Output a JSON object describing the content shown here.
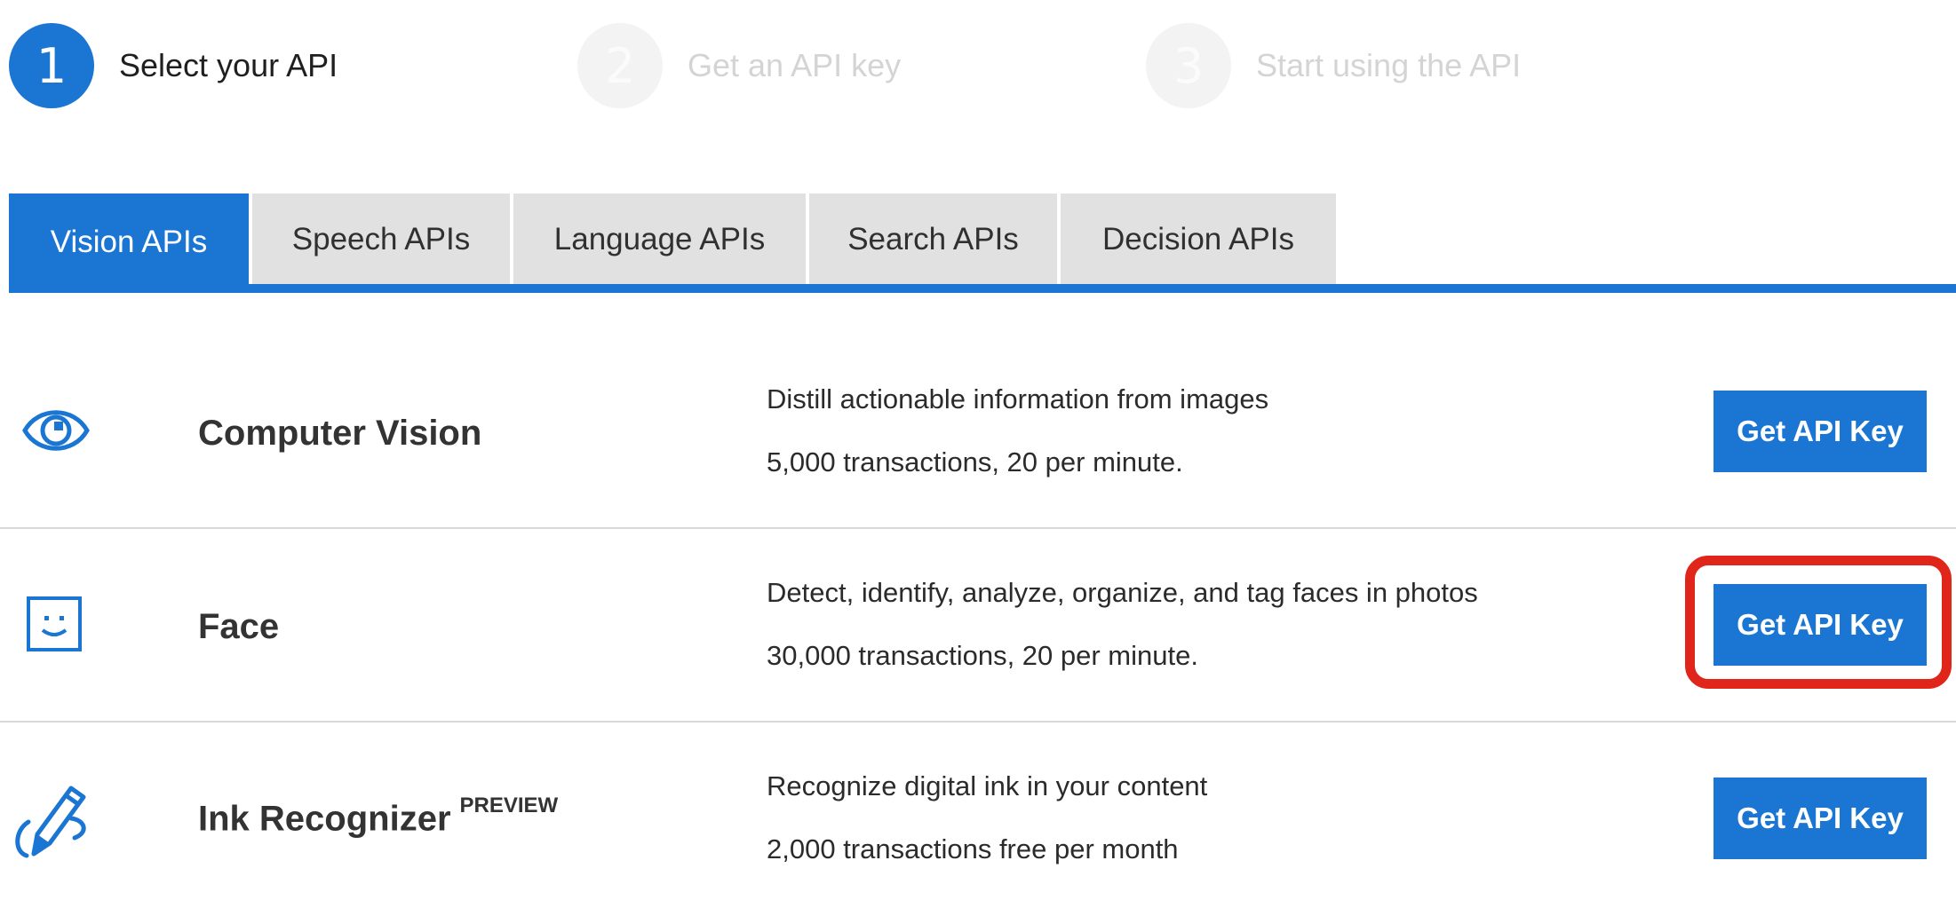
{
  "steps": [
    {
      "number": "1",
      "label": "Select your API"
    },
    {
      "number": "2",
      "label": "Get an API key"
    },
    {
      "number": "3",
      "label": "Start using the API"
    }
  ],
  "tabs": [
    {
      "label": "Vision APIs",
      "active": true
    },
    {
      "label": "Speech APIs",
      "active": false
    },
    {
      "label": "Language APIs",
      "active": false
    },
    {
      "label": "Search APIs",
      "active": false
    },
    {
      "label": "Decision APIs",
      "active": false
    }
  ],
  "apis": [
    {
      "icon": "eye-icon",
      "title": "Computer Vision",
      "badge": "",
      "description": "Distill actionable information from images",
      "quota": "5,000 transactions, 20 per minute.",
      "button_label": "Get API Key"
    },
    {
      "icon": "smiley-face-icon",
      "title": "Face",
      "badge": "",
      "description": "Detect, identify, analyze, organize, and tag faces in photos",
      "quota": "30,000 transactions, 20 per minute.",
      "button_label": "Get API Key"
    },
    {
      "icon": "pen-ink-icon",
      "title": "Ink Recognizer",
      "badge": "PREVIEW",
      "description": "Recognize digital ink in your content",
      "quota": "2,000 transactions free per month",
      "button_label": "Get API Key"
    }
  ],
  "colors": {
    "accent": "#1a76d2",
    "tab_inactive": "#e1e1e1",
    "highlight": "#e0251b",
    "step_inactive": "#f3f3f3"
  }
}
